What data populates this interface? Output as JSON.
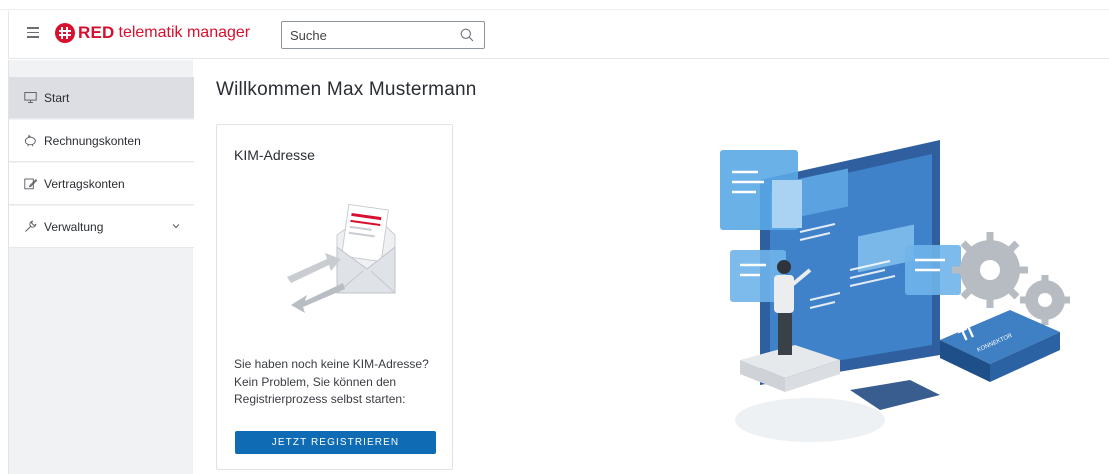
{
  "header": {
    "brand_bold": "RED",
    "brand_rest": "telematik manager",
    "search_placeholder": "Suche",
    "search_value": ""
  },
  "sidebar": {
    "items": [
      {
        "label": "Start",
        "icon": "monitor-icon",
        "active": true
      },
      {
        "label": "Rechnungskonten",
        "icon": "piggy-bank-icon",
        "active": false
      },
      {
        "label": "Vertragskonten",
        "icon": "contract-edit-icon",
        "active": false
      },
      {
        "label": "Verwaltung",
        "icon": "wrench-icon",
        "active": false,
        "expandable": true
      }
    ]
  },
  "main": {
    "title": "Willkommen Max Mustermann",
    "card": {
      "title": "KIM-Adresse",
      "text_lines": [
        "Sie haben noch keine KIM-Adresse?",
        "Kein Problem, Sie können den",
        "Registrierprozess selbst starten:"
      ],
      "button_label": "JETZT REGISTRIEREN",
      "illustration": "envelope-arrows-illustration"
    },
    "hero_illustration": "ti-konnektor-monitor-illustration",
    "hero_label_top": "TI",
    "hero_label_device": "KONNEKTOR"
  },
  "colors": {
    "brand_red": "#d8102e",
    "button_blue": "#0f6bb4",
    "sidebar_active": "#dcdee3"
  }
}
